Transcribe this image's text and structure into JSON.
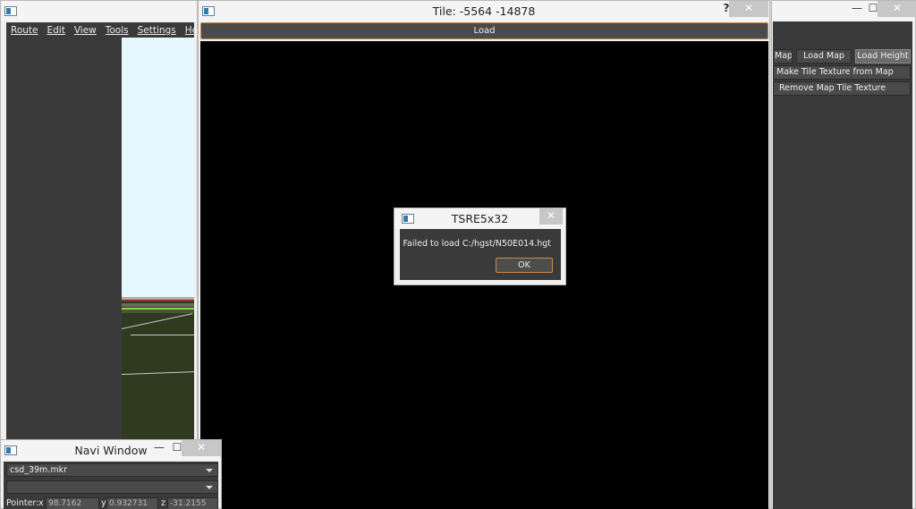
{
  "main_window": {
    "menu": [
      {
        "label": "Route"
      },
      {
        "label": "Edit"
      },
      {
        "label": "View"
      },
      {
        "label": "Tools"
      },
      {
        "label": "Settings"
      },
      {
        "label": "Help"
      }
    ]
  },
  "tile_window": {
    "title": "Tile: -5564 -14878",
    "help_label": "?",
    "close_label": "✕",
    "load_label": "Load"
  },
  "tools_window": {
    "minimize_label": "—",
    "maximize_label": "☐",
    "close_label": "✕",
    "buttons": {
      "map_partial": "Map",
      "load_map": "Load Map",
      "load_height": "Load Height",
      "make_tile_texture": "Make Tile Texture from Map",
      "remove_map_tile_texture": "Remove Map Tile Texture"
    }
  },
  "navi_window": {
    "title": "Navi Window",
    "minimize_label": "—",
    "maximize_label": "☐",
    "close_label": "✕",
    "marker_file": "csd_39m.mkr",
    "second_combo": "",
    "pointer_label": "Pointer:",
    "x_label": "x",
    "x_value": "98.7162",
    "y_label": "y",
    "y_value": "0.932731",
    "z_label": "z",
    "z_value": "-31.2155"
  },
  "dialog": {
    "title": "TSRE5x32",
    "close_label": "✕",
    "message": "Failed to load C:/hgst/N50E014.hgt",
    "ok_label": "OK"
  },
  "colors": {
    "panel_dark": "#3a3a3a",
    "viewport": "#000000",
    "sky": "#e5f7ff",
    "ground": "#2f3a1e",
    "accent_border": "#c78a4a"
  }
}
